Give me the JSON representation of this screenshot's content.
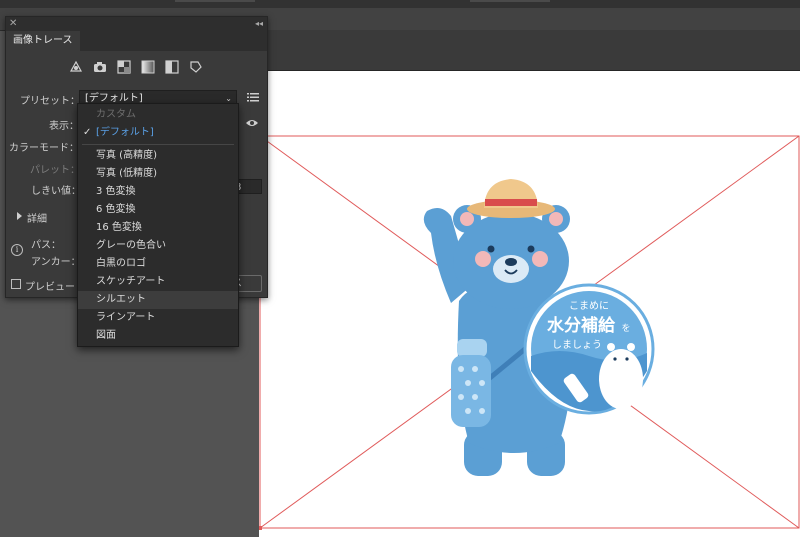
{
  "panel": {
    "tab": "画像トレース",
    "close": "✕",
    "collapse": "◂◂",
    "preset_label": "プリセット：",
    "preset_value": "[デフォルト]",
    "view_label": "表示：",
    "color_mode_label": "カラーモード：",
    "palette_label": "パレット：",
    "threshold_label": "しきい値：",
    "threshold_value": "8",
    "advanced_label": "詳細",
    "paths_label": "パス：",
    "anchors_label": "アンカー：",
    "preview_label": "プレビュー",
    "trace_button": "ス",
    "mode_icons": [
      "auto-color-icon",
      "high-color-icon",
      "low-color-icon",
      "grayscale-icon",
      "black-white-icon",
      "outline-icon"
    ]
  },
  "preset_menu": {
    "items": [
      {
        "label": "カスタム",
        "state": "disabled"
      },
      {
        "label": "[デフォルト]",
        "state": "selected"
      },
      {
        "label": "写真 (高精度)",
        "state": "normal"
      },
      {
        "label": "写真 (低精度)",
        "state": "normal"
      },
      {
        "label": "3 色変換",
        "state": "normal"
      },
      {
        "label": "6 色変換",
        "state": "normal"
      },
      {
        "label": "16 色変換",
        "state": "normal"
      },
      {
        "label": "グレーの色合い",
        "state": "normal"
      },
      {
        "label": "白黒のロゴ",
        "state": "normal"
      },
      {
        "label": "スケッチアート",
        "state": "normal"
      },
      {
        "label": "シルエット",
        "state": "hover"
      },
      {
        "label": "ラインアート",
        "state": "normal"
      },
      {
        "label": "図面",
        "state": "normal"
      }
    ]
  },
  "artwork": {
    "badge_line1": "こまめに",
    "badge_line2": "水分補給",
    "badge_particle": "を",
    "badge_line3": "しましょう"
  },
  "colors": {
    "bear": "#5b9fd4",
    "bear_dark": "#3f7fb8",
    "badge": "#6aaee0",
    "frame": "#e05a5a",
    "selected_text": "#5aa0e6"
  }
}
